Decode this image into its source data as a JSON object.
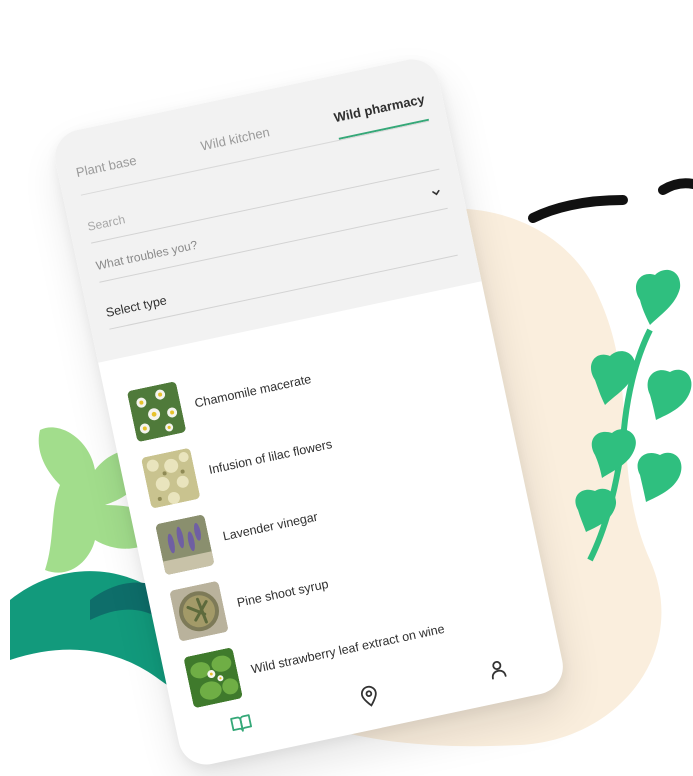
{
  "tabs": [
    {
      "label": "Plant base",
      "active": false
    },
    {
      "label": "Wild kitchen",
      "active": false
    },
    {
      "label": "Wild pharmacy",
      "active": true
    }
  ],
  "filters": {
    "search_placeholder": "Search",
    "troubles_placeholder": "What troubles you?",
    "type_label": "Select type"
  },
  "items": [
    {
      "label": "Chamomile macerate",
      "image": "chamomile-photo"
    },
    {
      "label": "Infusion of lilac flowers",
      "image": "lilac-photo"
    },
    {
      "label": "Lavender vinegar",
      "image": "lavender-photo"
    },
    {
      "label": "Pine shoot syrup",
      "image": "pine-syrup-photo"
    },
    {
      "label": "Wild strawberry leaf extract on wine",
      "image": "strawberry-leaf-photo"
    }
  ],
  "nav": [
    {
      "icon": "book-icon",
      "active": true
    },
    {
      "icon": "location-pin-icon",
      "active": false
    },
    {
      "icon": "user-icon",
      "active": false
    }
  ],
  "colors": {
    "accent": "#35a878",
    "leaf_light": "#9fdc8a",
    "leaf_mid": "#2fbf7f",
    "leaf_dark": "#138f7a",
    "blob": "#faeedd"
  }
}
